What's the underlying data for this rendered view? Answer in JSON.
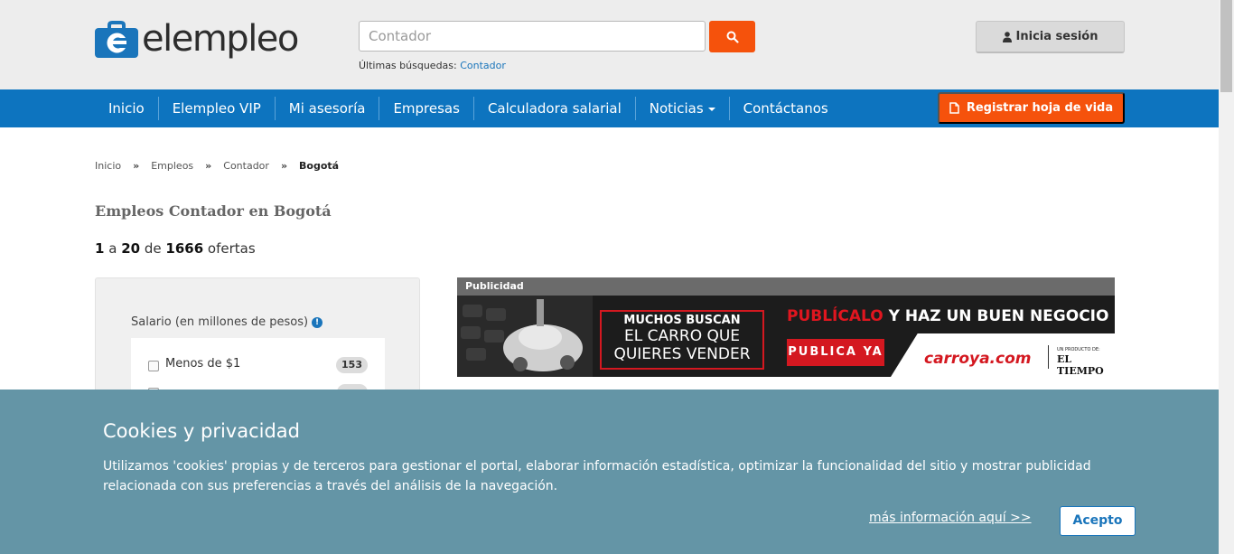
{
  "header": {
    "logo_text": "elempleo",
    "search": {
      "placeholder": "Contador",
      "value": ""
    },
    "recent_label": "Últimas búsquedas:",
    "recent_link": "Contador",
    "login_label": "Inicia sesión"
  },
  "nav": {
    "items": [
      {
        "label": "Inicio"
      },
      {
        "label": "Elempleo VIP"
      },
      {
        "label": "Mi asesoría"
      },
      {
        "label": "Empresas"
      },
      {
        "label": "Calculadora salarial"
      },
      {
        "label": "Noticias"
      },
      {
        "label": "Contáctanos"
      }
    ],
    "register_label": "Registrar hoja de vida"
  },
  "breadcrumb": {
    "items": [
      "Inicio",
      "Empleos",
      "Contador"
    ],
    "separator": "»",
    "current": "Bogotá"
  },
  "main": {
    "title": "Empleos Contador en Bogotá",
    "results": {
      "from": "1",
      "a": "a",
      "to": "20",
      "de": "de",
      "total": "1666",
      "suffix": "ofertas"
    }
  },
  "filters": {
    "salary_title": "Salario (en millones de pesos)",
    "options": [
      {
        "label": "Menos de $1",
        "count": "153"
      },
      {
        "label": "",
        "count": ""
      }
    ]
  },
  "ad": {
    "label": "Publicidad",
    "box_line1": "MUCHOS BUSCAN",
    "box_line2": "EL CARRO QUE",
    "box_line3": "QUIERES VENDER",
    "headline_red": "PUBLÍCALO",
    "headline_white": " Y HAZ UN BUEN NEGOCIO",
    "cta": "PUBLICA YA",
    "brand": "carroya.com",
    "tagline": "UN PRODUCTO DE:",
    "paper": "EL TIEMPO"
  },
  "cookie": {
    "title": "Cookies y privacidad",
    "text": "Utilizamos 'cookies' propias y de terceros para gestionar el portal, elaborar información estadística, optimizar la funcionalidad del sitio y mostrar publicidad relacionada con sus preferencias a través del análisis de la navegación.",
    "link": "más información aquí >>",
    "accept": "Acepto"
  },
  "colors": {
    "brand_blue": "#0d74bf",
    "accent_orange": "#f5520c",
    "cookie_bg": "#6495a6"
  }
}
